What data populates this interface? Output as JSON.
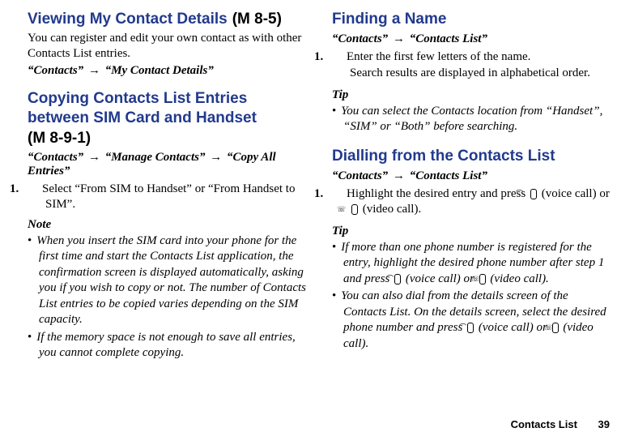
{
  "left": {
    "h1": "Viewing My Contact Details",
    "h1m": "(M 8-5)",
    "intro": "You can register and edit your own contact as with other Contacts List entries.",
    "path1a": "“Contacts”",
    "path1b": "“My Contact Details”",
    "h2a": "Copying Contacts List Entries between SIM Card and Handset",
    "h2m": "(M 8-9-1)",
    "path2a": "“Contacts”",
    "path2b": "“Manage Contacts”",
    "path2c": "“Copy All Entries”",
    "step1_n": "1.",
    "step1": "Select “From SIM to Handset” or “From Handset to SIM”.",
    "note_h": "Note",
    "note1": "When you insert the SIM card into your phone for the first time and start the Contacts List application, the confirmation screen is displayed automatically, asking you if you wish to copy or not. The number of Contacts List entries to be copied varies depending on the SIM capacity.",
    "note2": "If the memory space is not enough to save all entries, you cannot complete copying."
  },
  "right": {
    "h1": "Finding a Name",
    "path1a": "“Contacts”",
    "path1b": "“Contacts List”",
    "step1_n": "1.",
    "step1": "Enter the first few letters of the name.",
    "step1b": "Search results are displayed in alphabetical order.",
    "tip_h": "Tip",
    "tip1": "You can select the Contacts location from “Handset”, “SIM” or “Both” before searching.",
    "h2": "Dialling from the Contacts List",
    "path2a": "“Contacts”",
    "path2b": "“Contacts List”",
    "step2_n": "1.",
    "step2a": "Highlight the desired entry and press ",
    "step2b": " (voice call) or ",
    "step2c": " (video call).",
    "tip2_h": "Tip",
    "tip2a_1": "If more than one phone number is registered for the entry, highlight the desired phone number after step 1 and press ",
    "tip2a_2": " (voice call) or ",
    "tip2a_3": " (video call).",
    "tip2b_1": "You can also dial from the details screen of the Contacts List. On the details screen, select the desired phone number and press ",
    "tip2b_2": " (voice call) or ",
    "tip2b_3": " (video call)."
  },
  "keys": {
    "call": "⌒",
    "video": "☏"
  },
  "footer": {
    "section": "Contacts List",
    "page": "39"
  },
  "arrow": "→"
}
